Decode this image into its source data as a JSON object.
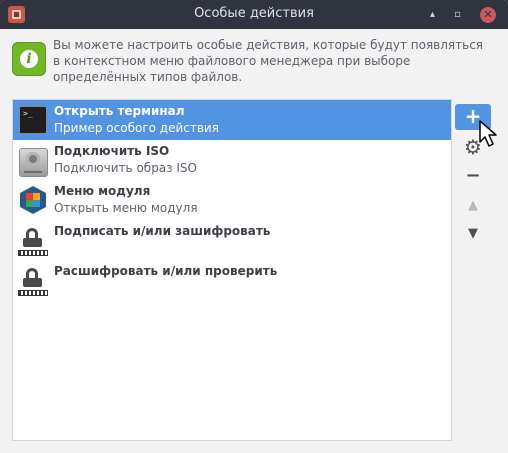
{
  "window": {
    "title": "Особые действия",
    "minimize_glyph": "▴",
    "maximize_glyph": "▫",
    "close_glyph": "✕"
  },
  "info": {
    "icon": "info-icon",
    "icon_glyph": "i",
    "text": "Вы можете настроить особые действия, которые будут появляться в контекстном меню файлового менеджера при выборе определённых типов файлов."
  },
  "actions": [
    {
      "name": "Открыть терминал",
      "description": "Пример особого действия",
      "icon": "terminal-icon",
      "icon_glyph": ">_",
      "selected": true
    },
    {
      "name": "Подключить ISO",
      "description": "Подключить образ ISO",
      "icon": "disk-icon",
      "selected": false
    },
    {
      "name": "Меню модуля",
      "description": "Открыть меню модуля",
      "icon": "module-icon",
      "selected": false
    },
    {
      "name": "Подписать и/или зашифровать",
      "description": "",
      "icon": "lock-icon",
      "selected": false
    },
    {
      "name": "Расшифровать и/или проверить",
      "description": "",
      "icon": "lock-icon",
      "selected": false
    }
  ],
  "side_buttons": {
    "add": "+",
    "edit": "⚙",
    "remove": "−",
    "up": "▲",
    "down": "▼"
  },
  "colors": {
    "accent": "#5294e2",
    "titlebar": "#2f343f",
    "close": "#cc575d",
    "info_green": "#73b62a"
  }
}
